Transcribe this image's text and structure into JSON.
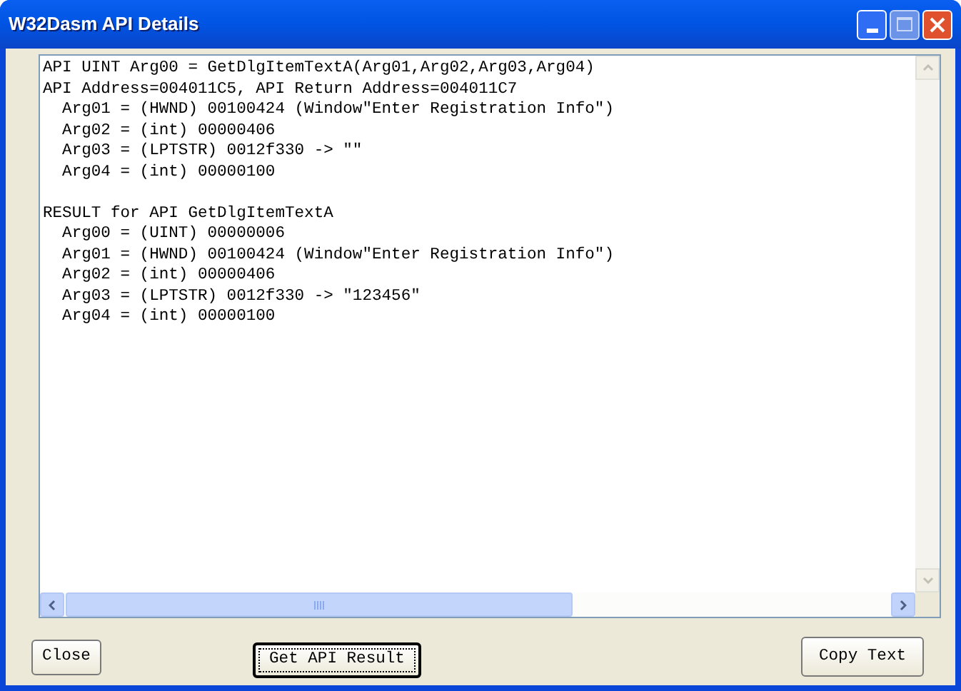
{
  "window": {
    "title": "W32Dasm API Details"
  },
  "text_blocks": [
    [
      "API UINT Arg00 = GetDlgItemTextA(Arg01,Arg02,Arg03,Arg04)",
      "API Address=004011C5, API Return Address=004011C7",
      "  Arg01 = (HWND) 00100424 (Window\"Enter Registration Info\")",
      "  Arg02 = (int) 00000406",
      "  Arg03 = (LPTSTR) 0012f330 -> \"\"",
      "  Arg04 = (int) 00000100"
    ],
    [
      "RESULT for API GetDlgItemTextA",
      "  Arg00 = (UINT) 00000006",
      "  Arg01 = (HWND) 00100424 (Window\"Enter Registration Info\")",
      "  Arg02 = (int) 00000406",
      "  Arg03 = (LPTSTR) 0012f330 -> \"123456\"",
      "  Arg04 = (int) 00000100"
    ]
  ],
  "buttons": [
    {
      "label": "Close",
      "default": false
    },
    {
      "label": "Get API Result",
      "default": true
    },
    {
      "label": "Copy Text",
      "default": false
    }
  ]
}
